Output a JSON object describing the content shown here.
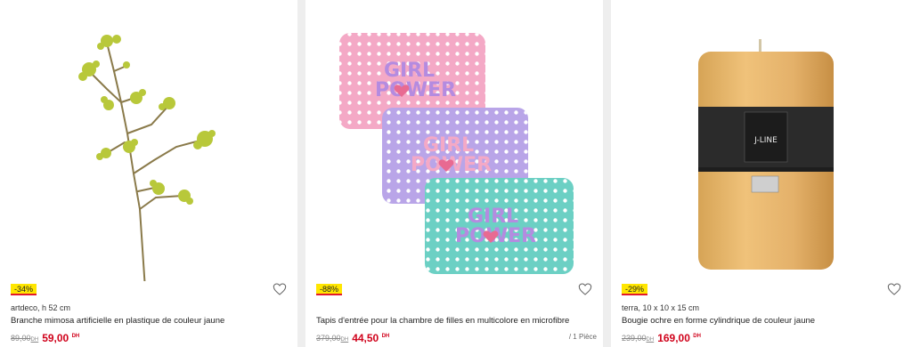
{
  "products": [
    {
      "discount": "-34%",
      "subtitle": "artdeco, h 52 cm",
      "title": "Branche mimosa artificielle en plastique de couleur jaune",
      "old_price": "89,00",
      "new_price": "59,00",
      "currency": "DH",
      "unit": ""
    },
    {
      "discount": "-88%",
      "subtitle": "",
      "title": "Tapis d'entrée pour la chambre de filles en multicolore en microfibre",
      "old_price": "379,00",
      "new_price": "44,50",
      "currency": "DH",
      "unit": "/ 1 Pièce",
      "mat_text_line1": "GIRL",
      "mat_text_line2": "POWER"
    },
    {
      "discount": "-29%",
      "subtitle": "terra, 10 x 10 x 15 cm",
      "title": "Bougie ochre en forme cylindrique de couleur jaune",
      "old_price": "239,00",
      "new_price": "169,00",
      "currency": "DH",
      "unit": "",
      "brand_label": "J-LINE"
    }
  ],
  "icons": {
    "wishlist": "heart-outline-icon"
  },
  "colors": {
    "discount_bg": "#ffe600",
    "discount_border": "#e2192c",
    "price": "#d0021b"
  }
}
